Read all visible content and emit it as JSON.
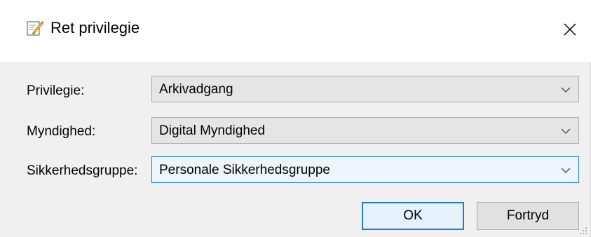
{
  "dialog": {
    "title": "Ret privilegie",
    "title_icon": "edit-document-icon",
    "close_icon": "close-icon"
  },
  "fields": [
    {
      "label": "Privilegie:",
      "value": "Arkivadgang"
    },
    {
      "label": "Myndighed:",
      "value": "Digital Myndighed"
    },
    {
      "label": "Sikkerhedsgruppe:",
      "value": "Personale Sikkerhedsgruppe"
    }
  ],
  "buttons": {
    "ok_label": "OK",
    "cancel_label": "Fortryd"
  },
  "colors": {
    "accent": "#1f7ad4",
    "client_bg": "#f0f0f0"
  }
}
